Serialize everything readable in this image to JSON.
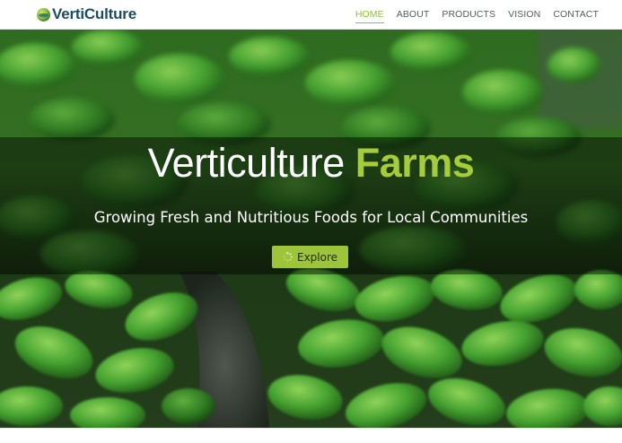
{
  "brand": {
    "name": "VertiCulture",
    "logo_icon": "globe-leaf-icon",
    "color": "#1d4b66"
  },
  "nav": {
    "items": [
      {
        "label": "HOME",
        "active": true
      },
      {
        "label": "ABOUT",
        "active": false
      },
      {
        "label": "PRODUCTS",
        "active": false
      },
      {
        "label": "VISION",
        "active": false
      },
      {
        "label": "CONTACT",
        "active": false
      }
    ],
    "active_color": "#8fbf3a"
  },
  "hero": {
    "title_main": "Verticulture ",
    "title_accent": "Farms",
    "subtitle": "Growing Fresh and Nutritious Foods for Local Communities",
    "button_label": "Explore",
    "button_icon": "spinner-icon",
    "accent_color": "#a6cc3c",
    "button_color": "#9ec43a",
    "background": "close-up photo of green microgreen seedlings"
  }
}
